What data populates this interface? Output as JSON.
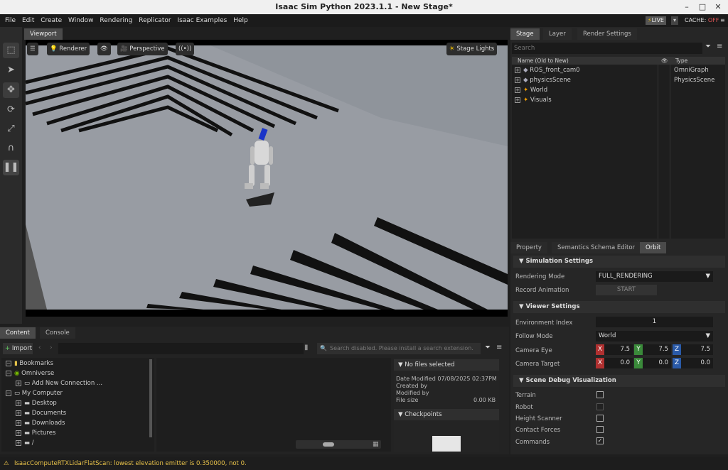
{
  "window": {
    "title": "Isaac Sim Python 2023.1.1 - New Stage*"
  },
  "menu": [
    "File",
    "Edit",
    "Create",
    "Window",
    "Rendering",
    "Replicator",
    "Isaac Examples",
    "Help"
  ],
  "live": {
    "label": "LIVE",
    "cache_label": "CACHE:",
    "cache_state": "OFF"
  },
  "viewport": {
    "tab": "Viewport",
    "renderer_label": "Renderer",
    "camera_label": "Perspective",
    "lights_label": "Stage Lights"
  },
  "stage_panel": {
    "tabs": [
      "Stage",
      "Layer",
      "Render Settings"
    ],
    "search_placeholder": "Search",
    "col_name": "Name (Old to New)",
    "col_type": "Type",
    "items": [
      {
        "name": "ROS_front_cam0",
        "type": "OmniGraph"
      },
      {
        "name": "physicsScene",
        "type": "PhysicsScene"
      },
      {
        "name": "World",
        "type": ""
      },
      {
        "name": "Visuals",
        "type": ""
      }
    ]
  },
  "property_panel": {
    "tabs": [
      "Property",
      "Semantics Schema Editor",
      "Orbit"
    ],
    "sim_settings": "Simulation Settings",
    "rendering_mode_label": "Rendering Mode",
    "rendering_mode_value": "FULL_RENDERING",
    "record_label": "Record Animation",
    "record_button": "START",
    "viewer_settings": "Viewer Settings",
    "env_index_label": "Environment Index",
    "env_index_value": "1",
    "follow_mode_label": "Follow Mode",
    "follow_mode_value": "World",
    "cam_eye_label": "Camera Eye",
    "cam_eye": [
      "7.5",
      "7.5",
      "7.5"
    ],
    "cam_target_label": "Camera Target",
    "cam_target": [
      "0.0",
      "0.0",
      "0.0"
    ],
    "axes": [
      "X",
      "Y",
      "Z"
    ],
    "debug_vis": "Scene Debug Visualization",
    "debug_items": [
      {
        "label": "Terrain",
        "checked": false
      },
      {
        "label": "Robot",
        "checked": false
      },
      {
        "label": "Height Scanner",
        "checked": false
      },
      {
        "label": "Contact Forces",
        "checked": false
      },
      {
        "label": "Commands",
        "checked": true
      }
    ]
  },
  "content_panel": {
    "tabs": [
      "Content",
      "Console"
    ],
    "import_label": "Import",
    "search_placeholder": "Search disabled. Please install a search extension.",
    "tree": [
      {
        "label": "Bookmarks",
        "indent": 0
      },
      {
        "label": "Omniverse",
        "indent": 0
      },
      {
        "label": "Add New Connection ...",
        "indent": 1
      },
      {
        "label": "My Computer",
        "indent": 0
      },
      {
        "label": "Desktop",
        "indent": 1
      },
      {
        "label": "Documents",
        "indent": 1
      },
      {
        "label": "Downloads",
        "indent": 1
      },
      {
        "label": "Pictures",
        "indent": 1
      },
      {
        "label": "/",
        "indent": 1
      }
    ],
    "no_files": "No files selected",
    "date_modified_label": "Date Modified",
    "date_modified_value": "07/08/2025 02:37PM",
    "created_by_label": "Created by",
    "modified_by_label": "Modified by",
    "file_size_label": "File size",
    "file_size_value": "0.00 KB",
    "checkpoints": "Checkpoints"
  },
  "status": {
    "message": "IsaacComputeRTXLidarFlatScan: lowest elevation emitter is 0.350000, not 0."
  }
}
